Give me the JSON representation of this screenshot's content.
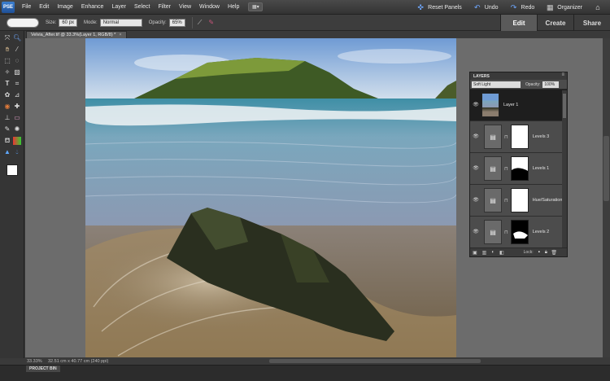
{
  "app": {
    "logo": "PSE"
  },
  "menu": [
    "File",
    "Edit",
    "Image",
    "Enhance",
    "Layer",
    "Select",
    "Filter",
    "View",
    "Window",
    "Help"
  ],
  "top_right": {
    "reset_panels": "Reset Panels",
    "undo": "Undo",
    "redo": "Redo",
    "organizer": "Organizer"
  },
  "options": {
    "size_label": "Size:",
    "size_value": "60 px",
    "mode_label": "Mode:",
    "mode_value": "Normal",
    "opacity_label": "Opacity:",
    "opacity_value": "65%"
  },
  "modes": {
    "edit": "Edit",
    "create": "Create",
    "share": "Share"
  },
  "document": {
    "tab_title": "Velvia_After.tif @ 33.3%(Layer 1, RGB/8) *",
    "close": "×"
  },
  "status": {
    "zoom": "33.33%",
    "size": "32.51 cm x 40.77 cm (240 ppi)"
  },
  "project_bin": {
    "label": "PROJECT BIN"
  },
  "layers_panel": {
    "title": "LAYERS",
    "blend_mode": "Soft Light",
    "opacity_label": "Opacity:",
    "opacity_value": "100%",
    "lock_label": "Lock:",
    "layers": [
      {
        "name": "Layer 1",
        "selected": true
      },
      {
        "name": "Levels 3",
        "selected": false
      },
      {
        "name": "Levels 1",
        "selected": false
      },
      {
        "name": "Hue/Saturation 1",
        "selected": false
      },
      {
        "name": "Levels 2",
        "selected": false
      }
    ]
  },
  "colors": {
    "accent": "#3b7fd1",
    "background": "#3a3a3a",
    "canvas_bg": "#6c6c6c"
  },
  "icons": {
    "eye": "eye-icon",
    "adjustment": "adjustment-layer-icon",
    "undo": "undo-icon",
    "redo": "redo-icon",
    "home": "home-icon"
  }
}
